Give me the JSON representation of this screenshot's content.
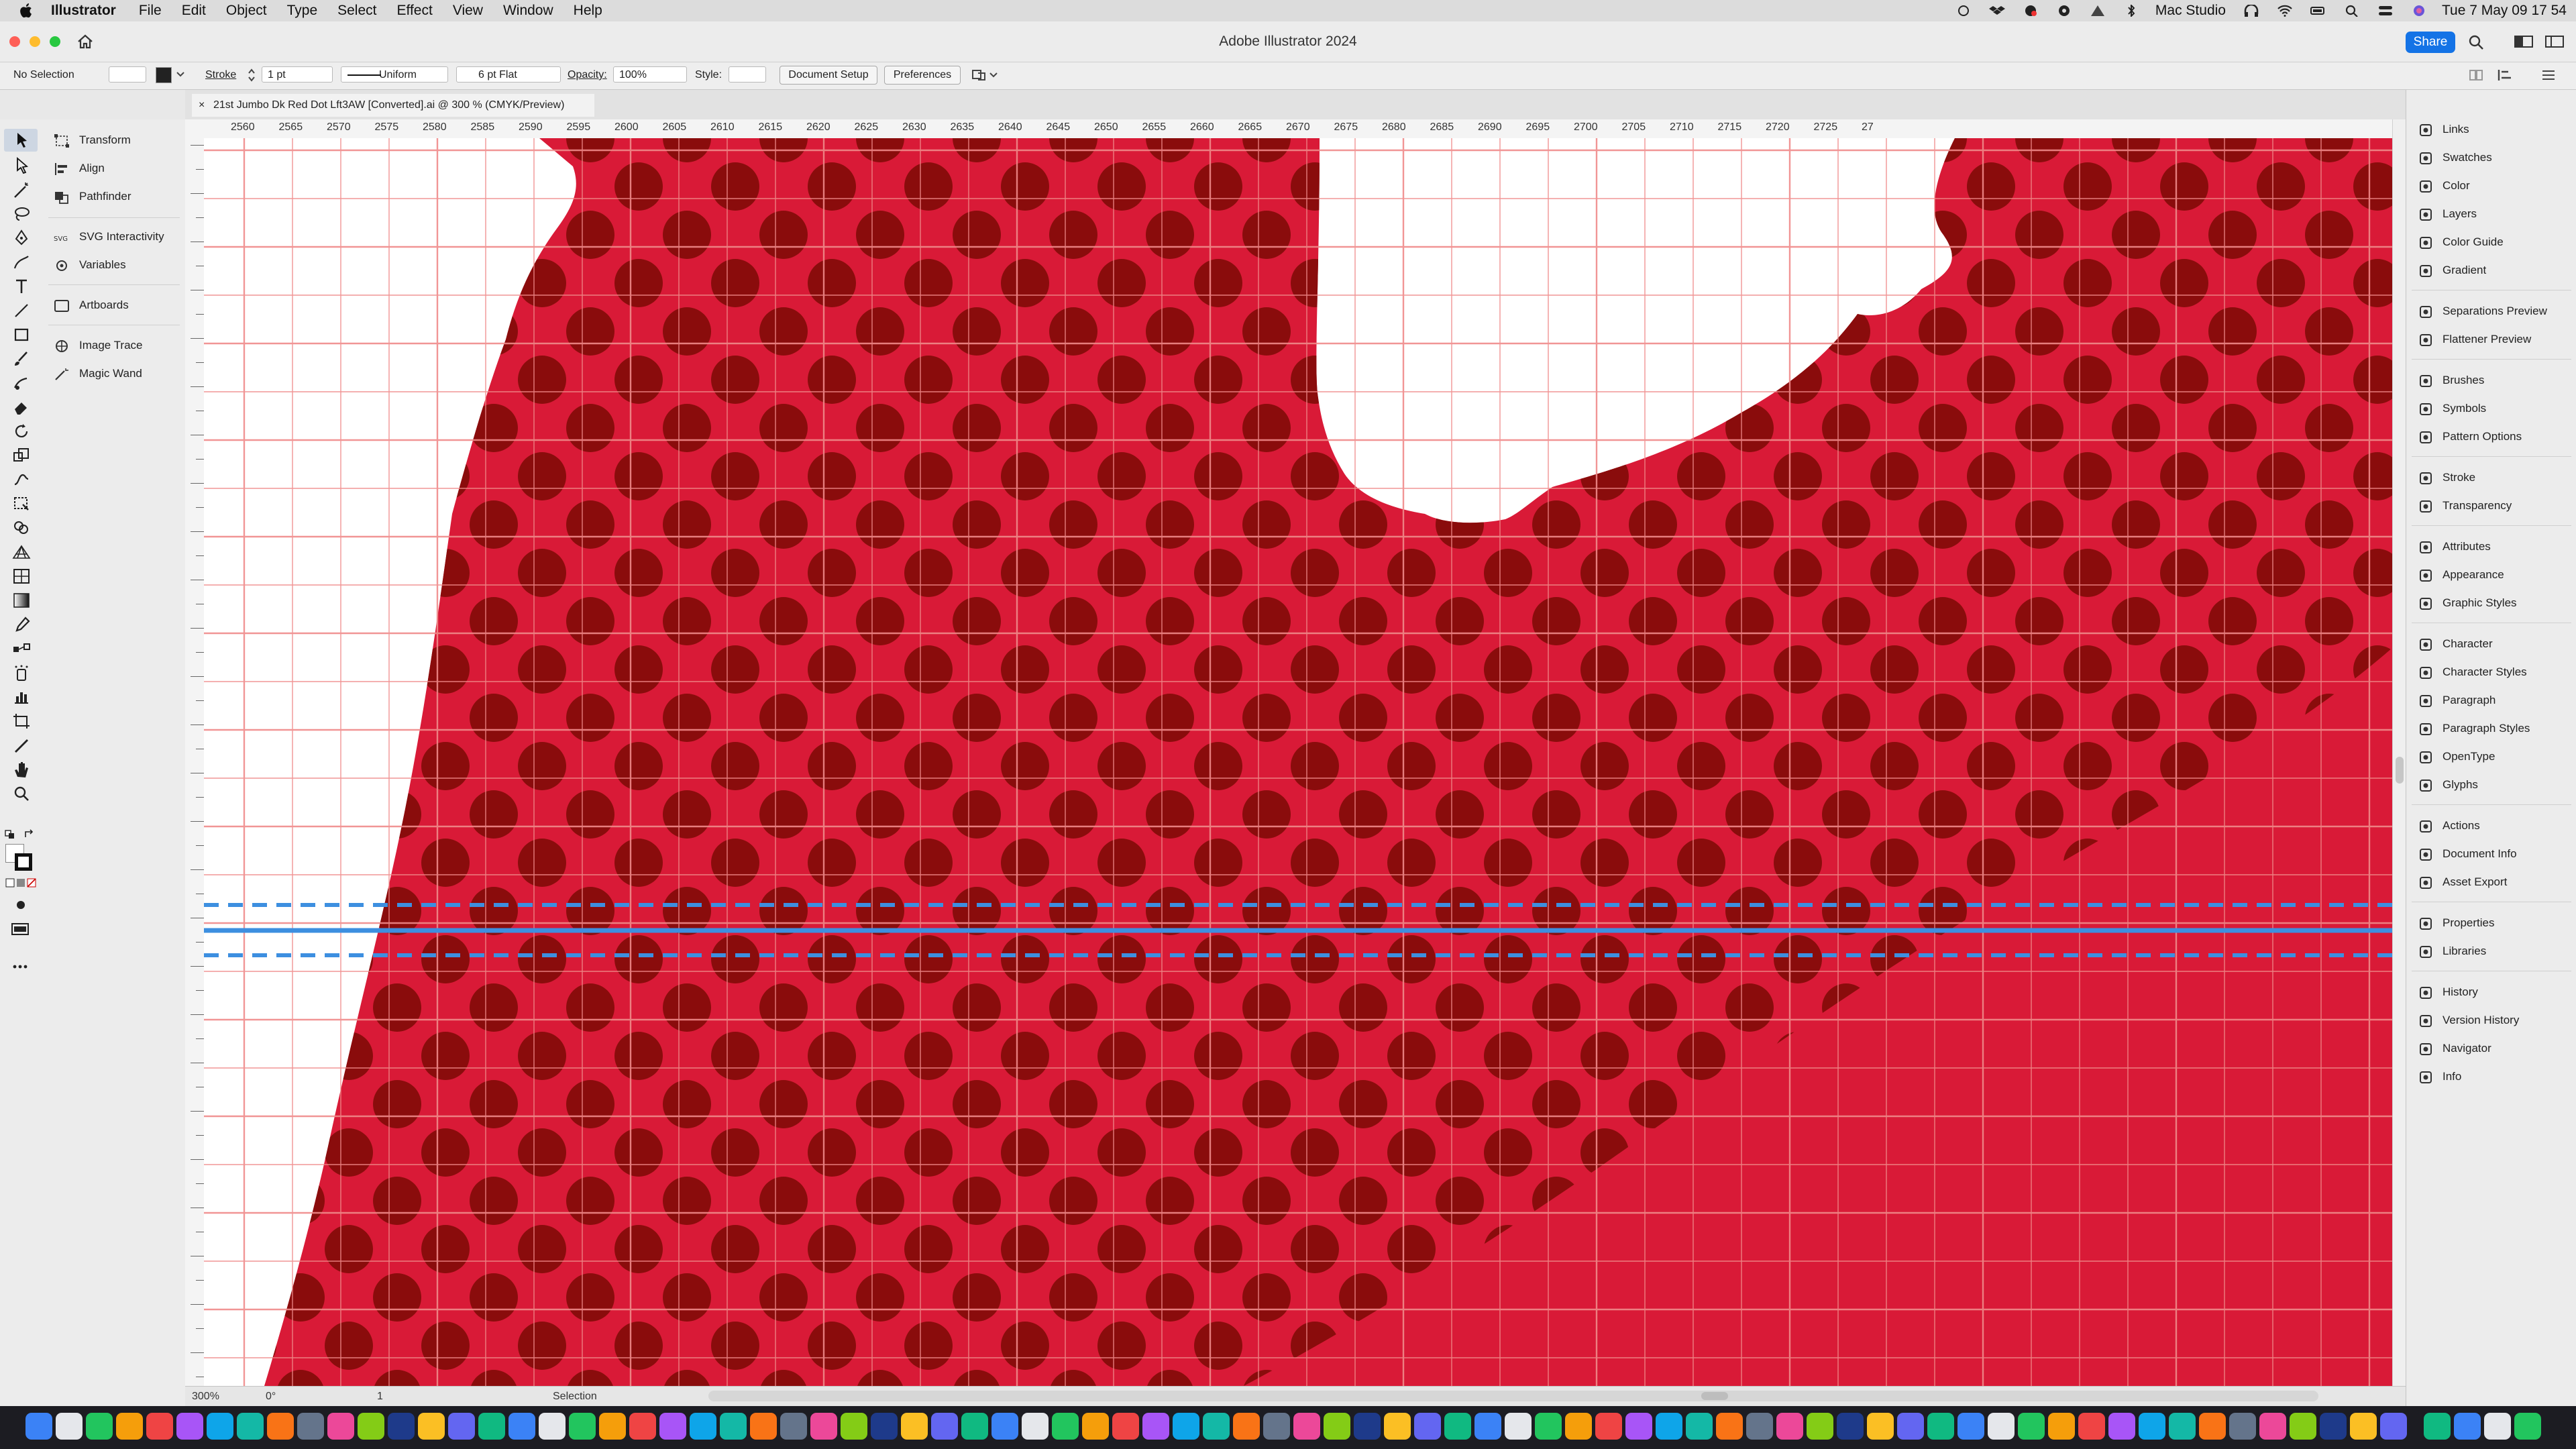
{
  "menubar": {
    "app_name": "Illustrator",
    "menus": [
      "File",
      "Edit",
      "Object",
      "Type",
      "Select",
      "Effect",
      "View",
      "Window",
      "Help"
    ],
    "device_name": "Mac Studio",
    "clock": "Tue 7 May  09 17 54"
  },
  "window": {
    "title": "Adobe Illustrator 2024",
    "share_label": "Share"
  },
  "control_bar": {
    "selection_label": "No Selection",
    "stroke_label": "Stroke",
    "stroke_weight": "1 pt",
    "profile": "Uniform",
    "brush": "6 pt Flat",
    "opacity_label": "Opacity:",
    "opacity_value": "100%",
    "style_label": "Style:",
    "document_setup_label": "Document Setup",
    "preferences_label": "Preferences"
  },
  "document_tab": {
    "title": "21st Jumbo Dk Red Dot Lft3AW [Converted].ai @ 300 % (CMYK/Preview)"
  },
  "ruler": {
    "ticks": [
      "2560",
      "2565",
      "2570",
      "2575",
      "2580",
      "2585",
      "2590",
      "2595",
      "2600",
      "2605",
      "2610",
      "2615",
      "2620",
      "2625",
      "2630",
      "2635",
      "2640",
      "2645",
      "2650",
      "2655",
      "2660",
      "2665",
      "2670",
      "2675",
      "2680",
      "2685",
      "2690",
      "2695",
      "2700",
      "2705",
      "2710",
      "2715",
      "2720",
      "2725",
      "27"
    ]
  },
  "left_panel": {
    "groups": [
      [
        "Transform",
        "Align",
        "Pathfinder"
      ],
      [
        "SVG Interactivity",
        "Variables"
      ],
      [
        "Artboards"
      ],
      [
        "Image Trace",
        "Magic Wand"
      ]
    ]
  },
  "right_panel": {
    "groups": [
      [
        "Links",
        "Swatches",
        "Color",
        "Layers",
        "Color Guide",
        "Gradient"
      ],
      [
        "Separations Preview",
        "Flattener Preview"
      ],
      [
        "Brushes",
        "Symbols",
        "Pattern Options"
      ],
      [
        "Stroke",
        "Transparency"
      ],
      [
        "Attributes",
        "Appearance",
        "Graphic Styles"
      ],
      [
        "Character",
        "Character Styles",
        "Paragraph",
        "Paragraph Styles",
        "OpenType",
        "Glyphs"
      ],
      [
        "Actions",
        "Document Info",
        "Asset Export"
      ],
      [
        "Properties",
        "Libraries"
      ],
      [
        "History",
        "Version History",
        "Navigator",
        "Info"
      ]
    ]
  },
  "status_bar": {
    "zoom": "300%",
    "rotation": "0°",
    "artboard": "1",
    "tool": "Selection"
  },
  "colors": {
    "artwork_red": "#d91a37",
    "dot_dark": "#8a0c0c",
    "grid": "#f08a8a",
    "guide_blue": "#3d8fe0",
    "accent": "#1473e6"
  }
}
